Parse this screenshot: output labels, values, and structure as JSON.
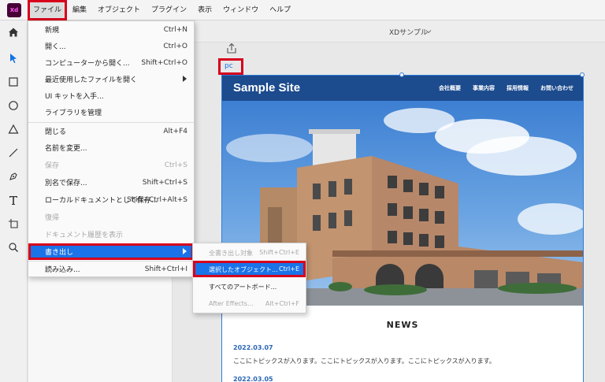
{
  "app": {
    "logo_text": "Xd",
    "brand_color": "#470137",
    "accent": "#1a73e8",
    "highlight_border": "#d6001c"
  },
  "menubar": {
    "items": [
      {
        "label": "ファイル",
        "active": true
      },
      {
        "label": "編集"
      },
      {
        "label": "オブジェクト"
      },
      {
        "label": "プラグイン"
      },
      {
        "label": "表示"
      },
      {
        "label": "ウィンドウ"
      },
      {
        "label": "ヘルプ"
      }
    ]
  },
  "toolbar": {
    "tools": [
      "home-icon",
      "select-icon",
      "rectangle-icon",
      "ellipse-icon",
      "polygon-icon",
      "line-icon",
      "pen-icon",
      "text-icon",
      "artboard-icon",
      "zoom-icon"
    ]
  },
  "document": {
    "title": "XDサンプル"
  },
  "file_menu": {
    "items": [
      {
        "label": "新規",
        "shortcut": "Ctrl+N"
      },
      {
        "label": "開く...",
        "shortcut": "Ctrl+O"
      },
      {
        "label": "コンピューターから開く...",
        "shortcut": "Shift+Ctrl+O"
      },
      {
        "label": "最近使用したファイルを開く",
        "shortcut": "",
        "submenu": true
      },
      {
        "label": "UI キットを入手...",
        "shortcut": ""
      },
      {
        "label": "ライブラリを管理",
        "shortcut": ""
      },
      {
        "label": "閉じる",
        "shortcut": "Alt+F4"
      },
      {
        "label": "名前を変更...",
        "shortcut": ""
      },
      {
        "label": "保存",
        "shortcut": "Ctrl+S",
        "disabled": true
      },
      {
        "label": "別名で保存...",
        "shortcut": "Shift+Ctrl+S"
      },
      {
        "label": "ローカルドキュメントとして保存...",
        "shortcut": "Shift+Ctrl+Alt+S"
      },
      {
        "label": "復帰",
        "shortcut": "",
        "disabled": true
      },
      {
        "label": "ドキュメント履歴を表示",
        "shortcut": "",
        "disabled": true
      },
      {
        "label": "書き出し",
        "shortcut": "",
        "submenu": true,
        "highlighted": true
      },
      {
        "label": "読み込み...",
        "shortcut": "Shift+Ctrl+I"
      }
    ]
  },
  "export_submenu": {
    "items": [
      {
        "label": "全書き出し対象",
        "shortcut": "Shift+Ctrl+E",
        "disabled": true
      },
      {
        "label": "選択したオブジェクト...",
        "shortcut": "Ctrl+E",
        "highlighted": true
      },
      {
        "label": "すべてのアートボード...",
        "shortcut": ""
      },
      {
        "label": "After Effects...",
        "shortcut": "Alt+Ctrl+F",
        "disabled": true
      }
    ]
  },
  "artboard": {
    "label": "pc",
    "site_title": "Sample Site",
    "nav": [
      "会社概要",
      "事業内容",
      "採用情報",
      "お問い合わせ"
    ],
    "news_heading": "NEWS",
    "news": [
      {
        "date": "2022.03.07",
        "text": "ここにトピックスが入ります。ここにトピックスが入ります。ここにトピックスが入ります。"
      },
      {
        "date": "2022.03.05"
      }
    ]
  }
}
